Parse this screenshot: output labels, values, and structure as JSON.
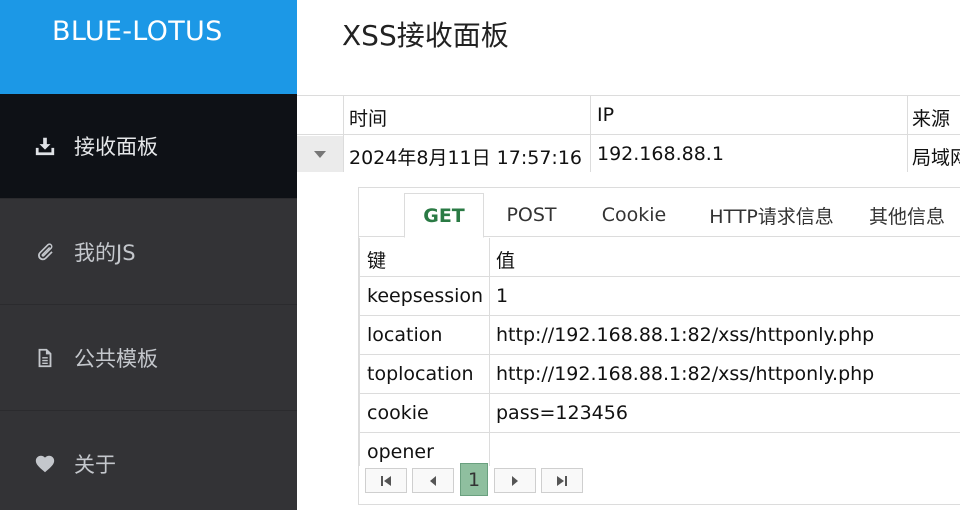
{
  "brand": "BLUE-LOTUS",
  "page_title": "XSS接收面板",
  "sidebar": {
    "items": [
      {
        "label": "接收面板",
        "icon": "download-icon",
        "active": true
      },
      {
        "label": "我的JS",
        "icon": "paperclip-icon",
        "active": false
      },
      {
        "label": "公共模板",
        "icon": "document-icon",
        "active": false
      },
      {
        "label": "关于",
        "icon": "heart-icon",
        "active": false
      }
    ]
  },
  "grid": {
    "columns": [
      "时间",
      "IP",
      "来源"
    ],
    "rows": [
      {
        "time": "2024年8月11日 17:57:16",
        "ip": "192.168.88.1",
        "source": "局域网"
      }
    ]
  },
  "detail": {
    "tabs": [
      "GET",
      "POST",
      "Cookie",
      "HTTP请求信息",
      "其他信息"
    ],
    "active_tab": "GET",
    "headers": {
      "key": "键",
      "value": "值"
    },
    "rows": [
      {
        "key": "keepsession",
        "value": "1"
      },
      {
        "key": "location",
        "value": "http://192.168.88.1:82/xss/httponly.php"
      },
      {
        "key": "toplocation",
        "value": "http://192.168.88.1:82/xss/httponly.php"
      },
      {
        "key": "cookie",
        "value": "pass=123456"
      },
      {
        "key": "opener",
        "value": ""
      }
    ],
    "pager": {
      "current_page": "1"
    }
  },
  "colors": {
    "brand_bg": "#1c98e6",
    "sidebar_bg": "#333336",
    "active_bg": "#0e1116",
    "active_tab_text": "#2a7a44",
    "page_btn": "#8fbf9f"
  }
}
